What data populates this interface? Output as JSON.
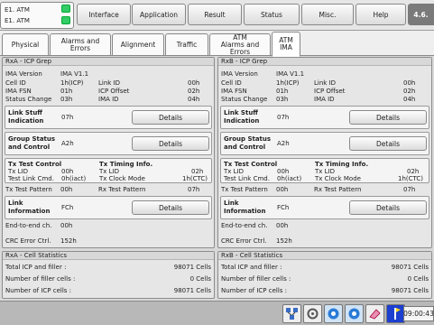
{
  "device": {
    "line1": "E1. ATM",
    "line2": "E1. ATM"
  },
  "menu": {
    "interface": "Interface",
    "application": "Application",
    "result": "Result",
    "status": "Status",
    "misc": "Misc.",
    "help": "Help",
    "version": "4.6."
  },
  "subtabs": {
    "physical": "Physical",
    "alarms_errors": "Alarms and Errors",
    "alignment": "Alignment",
    "traffic": "Traffic",
    "atm_alarms_l1": "ATM",
    "atm_alarms_l2": "Alarms and Errors",
    "atm_ima_l1": "ATM",
    "atm_ima_l2": "IMA"
  },
  "left": {
    "title": "RxA - ICP Grep",
    "ima_version_label": "IMA Version",
    "ima_version_val": "IMA V1.1",
    "cell_id_label": "Cell ID",
    "cell_id_val": "1h(ICP)",
    "link_id_label": "Link ID",
    "link_id_val": "00h",
    "ima_fsn_label": "IMA FSN",
    "ima_fsn_val": "01h",
    "icp_offset_label": "ICP Offset",
    "icp_offset_val": "02h",
    "status_change_label": "Status Change",
    "status_change_val": "03h",
    "ima_id_label": "IMA ID",
    "ima_id_val": "04h",
    "link_stuff_label": "Link Stuff Indication",
    "link_stuff_val": "07h",
    "details": "Details",
    "group_status_label": "Group Status and Control",
    "group_status_val": "A2h",
    "tx_test_title": "Tx Test Control",
    "tx_lid_label": "Tx LID",
    "tx_lid_val": "00h",
    "test_link_label": "Test Link Cmd.",
    "test_link_val": "0h(iact)",
    "timing_title": "Tx Timing Info.",
    "timing_lid_label": "Tx LID",
    "timing_lid_val": "02h",
    "clock_mode_label": "Tx Clock Mode",
    "clock_mode_val": "1h(CTC)",
    "tx_pattern_label": "Tx Test Pattern",
    "tx_pattern_val": "00h",
    "rx_pattern_label": "Rx Test Pattern",
    "rx_pattern_val": "07h",
    "link_info_label": "Link Information",
    "link_info_val": "FCh",
    "end_to_end_label": "End-to-end ch.",
    "end_to_end_val": "00h",
    "crc_label": "CRC Error Ctrl.",
    "crc_val": "152h"
  },
  "right": {
    "title": "RxB - ICP Grep",
    "ima_version_label": "IMA Version",
    "ima_version_val": "IMA V1.1",
    "cell_id_label": "Cell ID",
    "cell_id_val": "1h(ICP)",
    "link_id_label": "Link ID",
    "link_id_val": "00h",
    "ima_fsn_label": "IMA FSN",
    "ima_fsn_val": "01h",
    "icp_offset_label": "ICP Offset",
    "icp_offset_val": "02h",
    "status_change_label": "Status Change",
    "status_change_val": "03h",
    "ima_id_label": "IMA ID",
    "ima_id_val": "04h",
    "link_stuff_label": "Link Stuff Indication",
    "link_stuff_val": "07h",
    "details": "Details",
    "group_status_label": "Group Status and Control",
    "group_status_val": "A2h",
    "tx_test_title": "Tx Test Control",
    "tx_lid_label": "Tx LID",
    "tx_lid_val": "00h",
    "test_link_label": "Test Link Cmd.",
    "test_link_val": "0h(iact)",
    "timing_title": "Tx Timing Info.",
    "timing_lid_label": "Tx LID",
    "timing_lid_val": "02h",
    "clock_mode_label": "Tx Clock Mode",
    "clock_mode_val": "1h(CTC)",
    "tx_pattern_label": "Tx Test Pattern",
    "tx_pattern_val": "00h",
    "rx_pattern_label": "Rx Test Pattern",
    "rx_pattern_val": "07h",
    "link_info_label": "Link Information",
    "link_info_val": "FCh",
    "end_to_end_label": "End-to-end ch.",
    "end_to_end_val": "00h",
    "crc_label": "CRC Error Ctrl.",
    "crc_val": "152h"
  },
  "stats_left": {
    "title": "RxA - Cell Statistics",
    "r1_label": "Total ICP and filler  :",
    "r1_val": "98071 Cells",
    "r2_label": "Number of filler cells  :",
    "r2_val": "0 Cells",
    "r3_label": "Number of ICP cells  :",
    "r3_val": "98071 Cells"
  },
  "stats_right": {
    "title": "RxB - Cell Statistics",
    "r1_label": "Total ICP and filler  :",
    "r1_val": "98071 Cells",
    "r2_label": "Number of filler cells  :",
    "r2_val": "0 Cells",
    "r3_label": "Number of ICP cells  :",
    "r3_val": "98071 Cells"
  },
  "taskbar": {
    "clock": "09:00:43",
    "icons": [
      "network-icon",
      "settings-icon",
      "record-icon",
      "capture-icon",
      "eraser-icon",
      "flag-icon"
    ]
  },
  "colors": {
    "led": "#33cc66",
    "panel": "#e6e6e6",
    "taskbar": "#b8b8b8",
    "version_bg": "#7a7a7a"
  }
}
